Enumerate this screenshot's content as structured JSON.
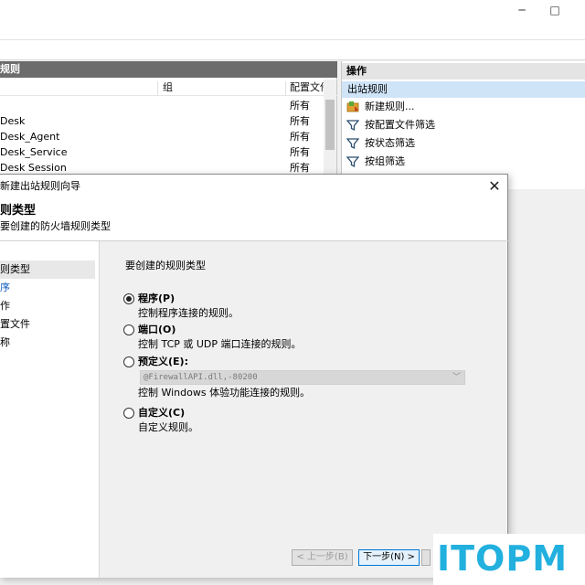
{
  "main_window": {
    "controls": {
      "minimize": "─",
      "maximize": "□"
    },
    "rules_pane": {
      "header": "规则",
      "columns": {
        "group": "组",
        "profile": "配置文件"
      },
      "rows": [
        {
          "name": "",
          "profile": "所有"
        },
        {
          "name": "Desk",
          "profile": "所有"
        },
        {
          "name": "Desk_Agent",
          "profile": "所有"
        },
        {
          "name": "Desk_Service",
          "profile": "所有"
        },
        {
          "name": "Desk Session",
          "profile": "所有"
        }
      ]
    },
    "actions_pane": {
      "header": "操作",
      "section": "出站规则",
      "items": [
        {
          "label": "新建规则...",
          "icon": "new-rule-icon"
        },
        {
          "label": "按配置文件筛选",
          "icon": "filter-icon"
        },
        {
          "label": "按状态筛选",
          "icon": "filter-icon"
        },
        {
          "label": "按组筛选",
          "icon": "filter-icon"
        }
      ]
    }
  },
  "wizard": {
    "title": "新建出站规则向导",
    "close": "✕",
    "heading": "则类型",
    "subheading": "要创建的防火墙规则类型",
    "steps": [
      "则类型",
      "序",
      "作",
      "置文件",
      "称"
    ],
    "prompt": "要创建的规则类型",
    "options": [
      {
        "label": "程序(P)",
        "desc": "控制程序连接的规则。",
        "checked": true
      },
      {
        "label": "端口(O)",
        "desc": "控制 TCP 或 UDP 端口连接的规则。",
        "checked": false
      },
      {
        "label": "预定义(E):",
        "desc": "控制 Windows 体验功能连接的规则。",
        "checked": false
      },
      {
        "label": "自定义(C)",
        "desc": "自定义规则。",
        "checked": false
      }
    ],
    "predefined_value": "@FirewallAPI.dll,-80200",
    "buttons": {
      "back": "< 上一步(B)",
      "next": "下一步(N) >"
    }
  },
  "watermark": {
    "text": "ITOPM",
    "color": "#22b0de"
  },
  "colors": {
    "accent": "#0078d7",
    "selection": "#cfe4f7",
    "header_dark": "#6c6c6c"
  }
}
